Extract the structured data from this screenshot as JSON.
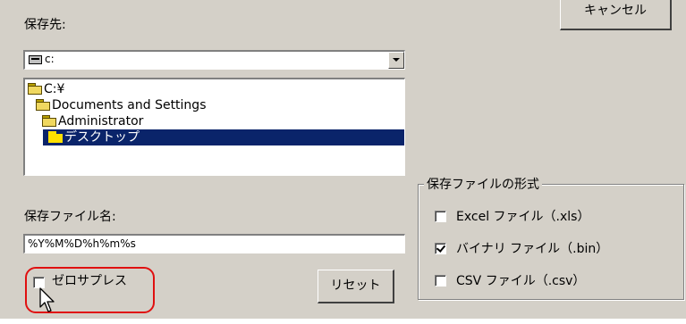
{
  "dialog": {
    "save_location_label": "保存先:",
    "cancel_button": "キャンセル",
    "drive_combo_value": "c:",
    "folder_tree": [
      {
        "label": "C:¥",
        "selected": false
      },
      {
        "label": "Documents and Settings",
        "selected": false
      },
      {
        "label": "Administrator",
        "selected": false
      },
      {
        "label": "デスクトップ",
        "selected": true
      }
    ],
    "file_name_label": "保存ファイル名:",
    "file_name_value": "%Y%M%D%h%m%s",
    "zero_suppress_label": "ゼロサプレス",
    "zero_suppress_checked": false,
    "reset_button": "リセット",
    "format_group": {
      "title": "保存ファイルの形式",
      "options": [
        {
          "label": "Excel ファイル（.xls）",
          "checked": false
        },
        {
          "label": "バイナリ ファイル（.bin）",
          "checked": true
        },
        {
          "label": "CSV ファイル（.csv）",
          "checked": false
        }
      ]
    }
  },
  "highlight_color": "#e01010",
  "selection_color": "#0a246a"
}
